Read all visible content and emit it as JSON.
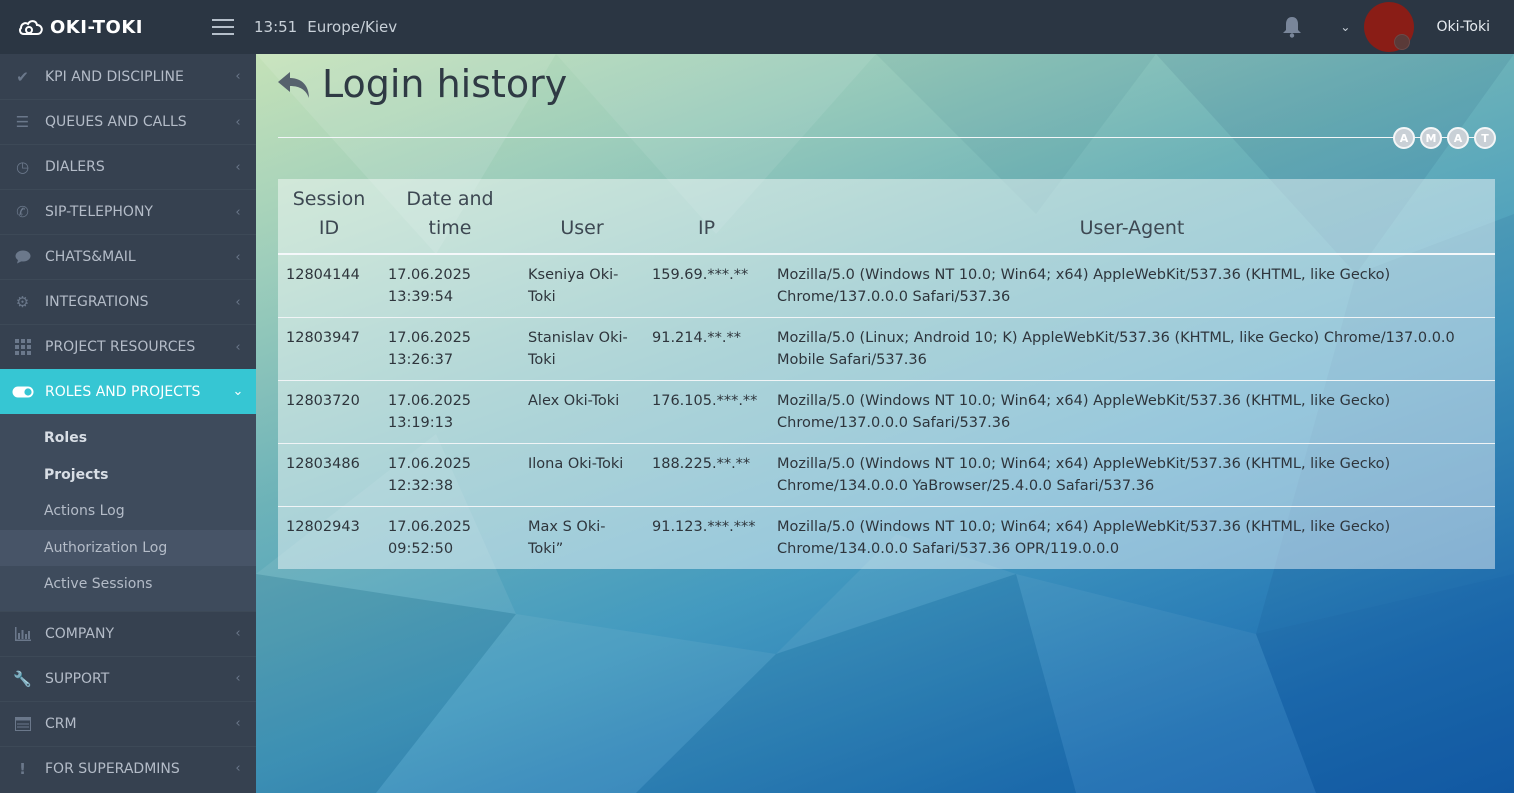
{
  "header": {
    "logo_text": "OKI-TOKI",
    "time": "13:51",
    "timezone": "Europe/Kiev",
    "username": "Oki-Toki"
  },
  "sidebar": {
    "items": [
      {
        "label": "KPI AND DISCIPLINE",
        "icon": "check-icon"
      },
      {
        "label": "QUEUES AND CALLS",
        "icon": "list-icon"
      },
      {
        "label": "DIALERS",
        "icon": "clock-icon"
      },
      {
        "label": "SIP-TELEPHONY",
        "icon": "phone-icon"
      },
      {
        "label": "CHATS&MAIL",
        "icon": "chat-icon"
      },
      {
        "label": "INTEGRATIONS",
        "icon": "gears-icon"
      },
      {
        "label": "PROJECT RESOURCES",
        "icon": "grid-icon"
      },
      {
        "label": "ROLES AND PROJECTS",
        "icon": "toggle-icon"
      },
      {
        "label": "COMPANY",
        "icon": "bar-chart-icon"
      },
      {
        "label": "SUPPORT",
        "icon": "wrench-icon"
      },
      {
        "label": "CRM",
        "icon": "table-icon"
      },
      {
        "label": "FOR SUPERADMINS",
        "icon": "exclamation-icon"
      }
    ],
    "submenu": [
      "Roles",
      "Projects",
      "Actions Log",
      "Authorization Log",
      "Active Sessions"
    ]
  },
  "page": {
    "title": "Login history",
    "initials": [
      "A",
      "M",
      "A",
      "T"
    ]
  },
  "table": {
    "headers": [
      "Session ID",
      "Date and time",
      "User",
      "IP",
      "User-Agent"
    ],
    "rows": [
      [
        "12804144",
        "17.06.2025 13:39:54",
        "Kseniya Oki-Toki",
        "159.69.***.**",
        "Mozilla/5.0 (Windows NT 10.0; Win64; x64) AppleWebKit/537.36 (KHTML, like Gecko) Chrome/137.0.0.0 Safari/537.36"
      ],
      [
        "12803947",
        "17.06.2025 13:26:37",
        "Stanislav Oki-Toki",
        "91.214.**.**",
        "Mozilla/5.0 (Linux; Android 10; K) AppleWebKit/537.36 (KHTML, like Gecko) Chrome/137.0.0.0 Mobile Safari/537.36"
      ],
      [
        "12803720",
        "17.06.2025 13:19:13",
        "Alex Oki-Toki",
        "176.105.***.**",
        "Mozilla/5.0 (Windows NT 10.0; Win64; x64) AppleWebKit/537.36 (KHTML, like Gecko) Chrome/137.0.0.0 Safari/537.36"
      ],
      [
        "12803486",
        "17.06.2025 12:32:38",
        "Ilona Oki-Toki",
        "188.225.**.**",
        "Mozilla/5.0 (Windows NT 10.0; Win64; x64) AppleWebKit/537.36 (KHTML, like Gecko) Chrome/134.0.0.0 YaBrowser/25.4.0.0 Safari/537.36"
      ],
      [
        "12802943",
        "17.06.2025 09:52:50",
        "Max S Oki-Toki”",
        "91.123.***.***",
        "Mozilla/5.0 (Windows NT 10.0; Win64; x64) AppleWebKit/537.36 (KHTML, like Gecko) Chrome/134.0.0.0 Safari/537.36 OPR/119.0.0.0"
      ]
    ]
  },
  "colors": {
    "sidebar_bg": "#364150",
    "topbar_bg": "#2b3643",
    "active_accent": "#36c6d3"
  }
}
